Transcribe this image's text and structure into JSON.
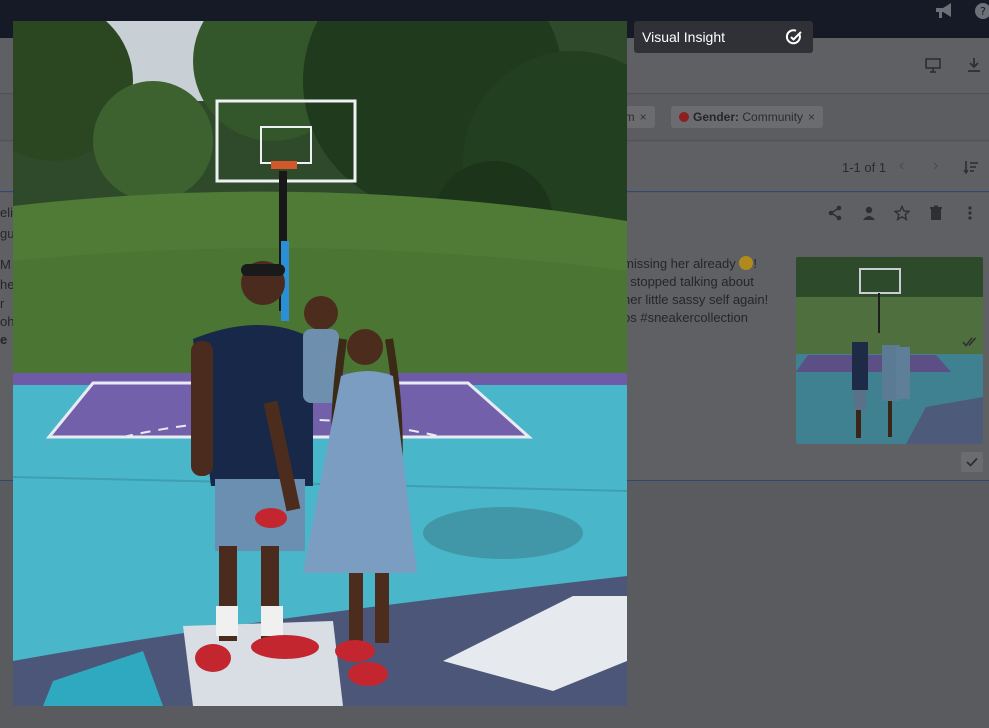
{
  "tooltip": {
    "label": "Visual Insight",
    "icon": "edit-check-icon"
  },
  "filters": [
    {
      "key": "",
      "value": "om"
    },
    {
      "key": "Gender:",
      "value": "Community",
      "status_color": "#8c1f1f"
    }
  ],
  "pager": {
    "range": "1-1 of 1"
  },
  "post": {
    "lines": [
      "missing her already",
      "t stopped talking about",
      "her little sassy self again!",
      "os #sneakercollection"
    ],
    "emoji": "!"
  },
  "left_fragments": [
    "M",
    "he",
    "r",
    "oh",
    "e",
    "eli",
    "gu"
  ],
  "icons": {
    "topbar": [
      "megaphone-icon",
      "help-icon"
    ],
    "toolbar": [
      "presentation-icon",
      "download-icon"
    ],
    "post_actions": [
      "share-icon",
      "person-icon",
      "star-icon",
      "trash-icon",
      "more-vertical-icon"
    ]
  }
}
